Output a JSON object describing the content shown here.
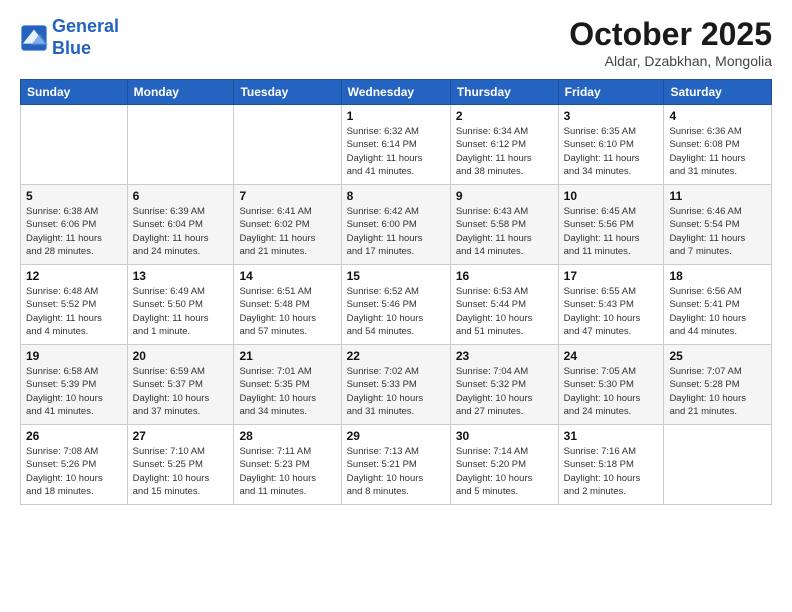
{
  "header": {
    "logo_line1": "General",
    "logo_line2": "Blue",
    "month_title": "October 2025",
    "location": "Aldar, Dzabkhan, Mongolia"
  },
  "days_of_week": [
    "Sunday",
    "Monday",
    "Tuesday",
    "Wednesday",
    "Thursday",
    "Friday",
    "Saturday"
  ],
  "weeks": [
    [
      {
        "num": "",
        "info": ""
      },
      {
        "num": "",
        "info": ""
      },
      {
        "num": "",
        "info": ""
      },
      {
        "num": "1",
        "info": "Sunrise: 6:32 AM\nSunset: 6:14 PM\nDaylight: 11 hours\nand 41 minutes."
      },
      {
        "num": "2",
        "info": "Sunrise: 6:34 AM\nSunset: 6:12 PM\nDaylight: 11 hours\nand 38 minutes."
      },
      {
        "num": "3",
        "info": "Sunrise: 6:35 AM\nSunset: 6:10 PM\nDaylight: 11 hours\nand 34 minutes."
      },
      {
        "num": "4",
        "info": "Sunrise: 6:36 AM\nSunset: 6:08 PM\nDaylight: 11 hours\nand 31 minutes."
      }
    ],
    [
      {
        "num": "5",
        "info": "Sunrise: 6:38 AM\nSunset: 6:06 PM\nDaylight: 11 hours\nand 28 minutes."
      },
      {
        "num": "6",
        "info": "Sunrise: 6:39 AM\nSunset: 6:04 PM\nDaylight: 11 hours\nand 24 minutes."
      },
      {
        "num": "7",
        "info": "Sunrise: 6:41 AM\nSunset: 6:02 PM\nDaylight: 11 hours\nand 21 minutes."
      },
      {
        "num": "8",
        "info": "Sunrise: 6:42 AM\nSunset: 6:00 PM\nDaylight: 11 hours\nand 17 minutes."
      },
      {
        "num": "9",
        "info": "Sunrise: 6:43 AM\nSunset: 5:58 PM\nDaylight: 11 hours\nand 14 minutes."
      },
      {
        "num": "10",
        "info": "Sunrise: 6:45 AM\nSunset: 5:56 PM\nDaylight: 11 hours\nand 11 minutes."
      },
      {
        "num": "11",
        "info": "Sunrise: 6:46 AM\nSunset: 5:54 PM\nDaylight: 11 hours\nand 7 minutes."
      }
    ],
    [
      {
        "num": "12",
        "info": "Sunrise: 6:48 AM\nSunset: 5:52 PM\nDaylight: 11 hours\nand 4 minutes."
      },
      {
        "num": "13",
        "info": "Sunrise: 6:49 AM\nSunset: 5:50 PM\nDaylight: 11 hours\nand 1 minute."
      },
      {
        "num": "14",
        "info": "Sunrise: 6:51 AM\nSunset: 5:48 PM\nDaylight: 10 hours\nand 57 minutes."
      },
      {
        "num": "15",
        "info": "Sunrise: 6:52 AM\nSunset: 5:46 PM\nDaylight: 10 hours\nand 54 minutes."
      },
      {
        "num": "16",
        "info": "Sunrise: 6:53 AM\nSunset: 5:44 PM\nDaylight: 10 hours\nand 51 minutes."
      },
      {
        "num": "17",
        "info": "Sunrise: 6:55 AM\nSunset: 5:43 PM\nDaylight: 10 hours\nand 47 minutes."
      },
      {
        "num": "18",
        "info": "Sunrise: 6:56 AM\nSunset: 5:41 PM\nDaylight: 10 hours\nand 44 minutes."
      }
    ],
    [
      {
        "num": "19",
        "info": "Sunrise: 6:58 AM\nSunset: 5:39 PM\nDaylight: 10 hours\nand 41 minutes."
      },
      {
        "num": "20",
        "info": "Sunrise: 6:59 AM\nSunset: 5:37 PM\nDaylight: 10 hours\nand 37 minutes."
      },
      {
        "num": "21",
        "info": "Sunrise: 7:01 AM\nSunset: 5:35 PM\nDaylight: 10 hours\nand 34 minutes."
      },
      {
        "num": "22",
        "info": "Sunrise: 7:02 AM\nSunset: 5:33 PM\nDaylight: 10 hours\nand 31 minutes."
      },
      {
        "num": "23",
        "info": "Sunrise: 7:04 AM\nSunset: 5:32 PM\nDaylight: 10 hours\nand 27 minutes."
      },
      {
        "num": "24",
        "info": "Sunrise: 7:05 AM\nSunset: 5:30 PM\nDaylight: 10 hours\nand 24 minutes."
      },
      {
        "num": "25",
        "info": "Sunrise: 7:07 AM\nSunset: 5:28 PM\nDaylight: 10 hours\nand 21 minutes."
      }
    ],
    [
      {
        "num": "26",
        "info": "Sunrise: 7:08 AM\nSunset: 5:26 PM\nDaylight: 10 hours\nand 18 minutes."
      },
      {
        "num": "27",
        "info": "Sunrise: 7:10 AM\nSunset: 5:25 PM\nDaylight: 10 hours\nand 15 minutes."
      },
      {
        "num": "28",
        "info": "Sunrise: 7:11 AM\nSunset: 5:23 PM\nDaylight: 10 hours\nand 11 minutes."
      },
      {
        "num": "29",
        "info": "Sunrise: 7:13 AM\nSunset: 5:21 PM\nDaylight: 10 hours\nand 8 minutes."
      },
      {
        "num": "30",
        "info": "Sunrise: 7:14 AM\nSunset: 5:20 PM\nDaylight: 10 hours\nand 5 minutes."
      },
      {
        "num": "31",
        "info": "Sunrise: 7:16 AM\nSunset: 5:18 PM\nDaylight: 10 hours\nand 2 minutes."
      },
      {
        "num": "",
        "info": ""
      }
    ]
  ]
}
